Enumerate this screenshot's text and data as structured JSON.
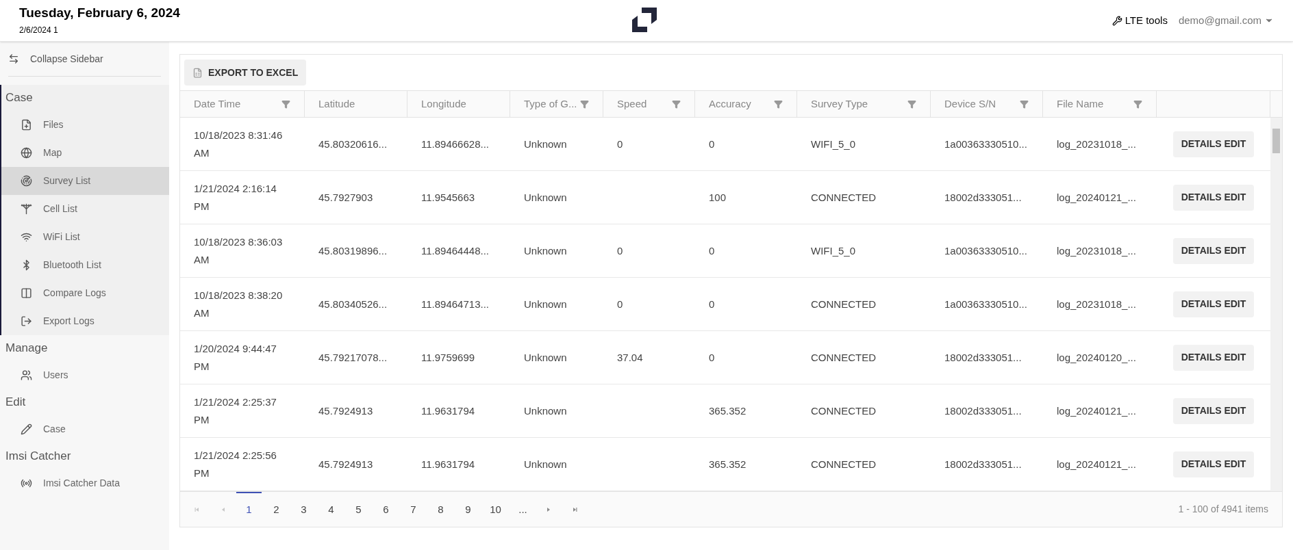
{
  "header": {
    "title": "Tuesday, February 6, 2024",
    "subtitle": "2/6/2024 1",
    "tools_link": "LTE tools",
    "user_menu": "demo@gmail.com"
  },
  "sidebar": {
    "collapse": "Collapse Sidebar",
    "groups": [
      {
        "title": "Case",
        "active": true,
        "items": [
          {
            "label": "Files",
            "selected": false
          },
          {
            "label": "Map",
            "selected": false
          },
          {
            "label": "Survey List",
            "selected": true
          },
          {
            "label": "Cell List",
            "selected": false
          },
          {
            "label": "WiFi List",
            "selected": false
          },
          {
            "label": "Bluetooth List",
            "selected": false
          },
          {
            "label": "Compare Logs",
            "selected": false
          },
          {
            "label": "Export Logs",
            "selected": false
          }
        ]
      },
      {
        "title": "Manage",
        "active": false,
        "items": [
          {
            "label": "Users",
            "selected": false
          }
        ]
      },
      {
        "title": "Edit",
        "active": false,
        "items": [
          {
            "label": "Case",
            "selected": false
          }
        ]
      },
      {
        "title": "Imsi Catcher",
        "active": false,
        "items": [
          {
            "label": "Imsi Catcher Data",
            "selected": false
          }
        ]
      }
    ]
  },
  "toolbar": {
    "export_button": "EXPORT TO EXCEL"
  },
  "table": {
    "columns": [
      {
        "label": "Date Time",
        "filter": true
      },
      {
        "label": "Latitude",
        "filter": false
      },
      {
        "label": "Longitude",
        "filter": false
      },
      {
        "label": "Type of G...",
        "filter": true
      },
      {
        "label": "Speed",
        "filter": true
      },
      {
        "label": "Accuracy",
        "filter": true
      },
      {
        "label": "Survey Type",
        "filter": true
      },
      {
        "label": "Device S/N",
        "filter": true
      },
      {
        "label": "File Name",
        "filter": true
      }
    ],
    "rows": [
      {
        "cells": [
          "10/18/2023 8:31:46 AM",
          "45.80320616...",
          "11.89466628...",
          "Unknown",
          "0",
          "0",
          "WIFI_5_0",
          "1a00363330510...",
          "log_20231018_..."
        ],
        "action": "DETAILS EDIT"
      },
      {
        "cells": [
          "1/21/2024 2:16:14 PM",
          "45.7927903",
          "11.9545663",
          "Unknown",
          "",
          "100",
          "CONNECTED",
          "18002d333051...",
          "log_20240121_..."
        ],
        "action": "DETAILS EDIT"
      },
      {
        "cells": [
          "10/18/2023 8:36:03 AM",
          "45.80319896...",
          "11.89464448...",
          "Unknown",
          "0",
          "0",
          "WIFI_5_0",
          "1a00363330510...",
          "log_20231018_..."
        ],
        "action": "DETAILS EDIT"
      },
      {
        "cells": [
          "10/18/2023 8:38:20 AM",
          "45.80340526...",
          "11.89464713...",
          "Unknown",
          "0",
          "0",
          "CONNECTED",
          "1a00363330510...",
          "log_20231018_..."
        ],
        "action": "DETAILS EDIT"
      },
      {
        "cells": [
          "1/20/2024 9:44:47 PM",
          "45.79217078...",
          "11.9759699",
          "Unknown",
          "37.04",
          "0",
          "CONNECTED",
          "18002d333051...",
          "log_20240120_..."
        ],
        "action": "DETAILS EDIT"
      },
      {
        "cells": [
          "1/21/2024 2:25:37 PM",
          "45.7924913",
          "11.9631794",
          "Unknown",
          "",
          "365.352",
          "CONNECTED",
          "18002d333051...",
          "log_20240121_..."
        ],
        "action": "DETAILS EDIT"
      },
      {
        "cells": [
          "1/21/2024 2:25:56 PM",
          "45.7924913",
          "11.9631794",
          "Unknown",
          "",
          "365.352",
          "CONNECTED",
          "18002d333051...",
          "log_20240121_..."
        ],
        "action": "DETAILS EDIT"
      }
    ]
  },
  "pagination": {
    "pages": [
      {
        "label": "1",
        "selected": true
      },
      {
        "label": "2",
        "selected": false
      },
      {
        "label": "3",
        "selected": false
      },
      {
        "label": "4",
        "selected": false
      },
      {
        "label": "5",
        "selected": false
      },
      {
        "label": "6",
        "selected": false
      },
      {
        "label": "7",
        "selected": false
      },
      {
        "label": "8",
        "selected": false
      },
      {
        "label": "9",
        "selected": false
      },
      {
        "label": "10",
        "selected": false
      },
      {
        "label": "...",
        "selected": false
      }
    ],
    "summary": "1 - 100 of 4941 items"
  }
}
